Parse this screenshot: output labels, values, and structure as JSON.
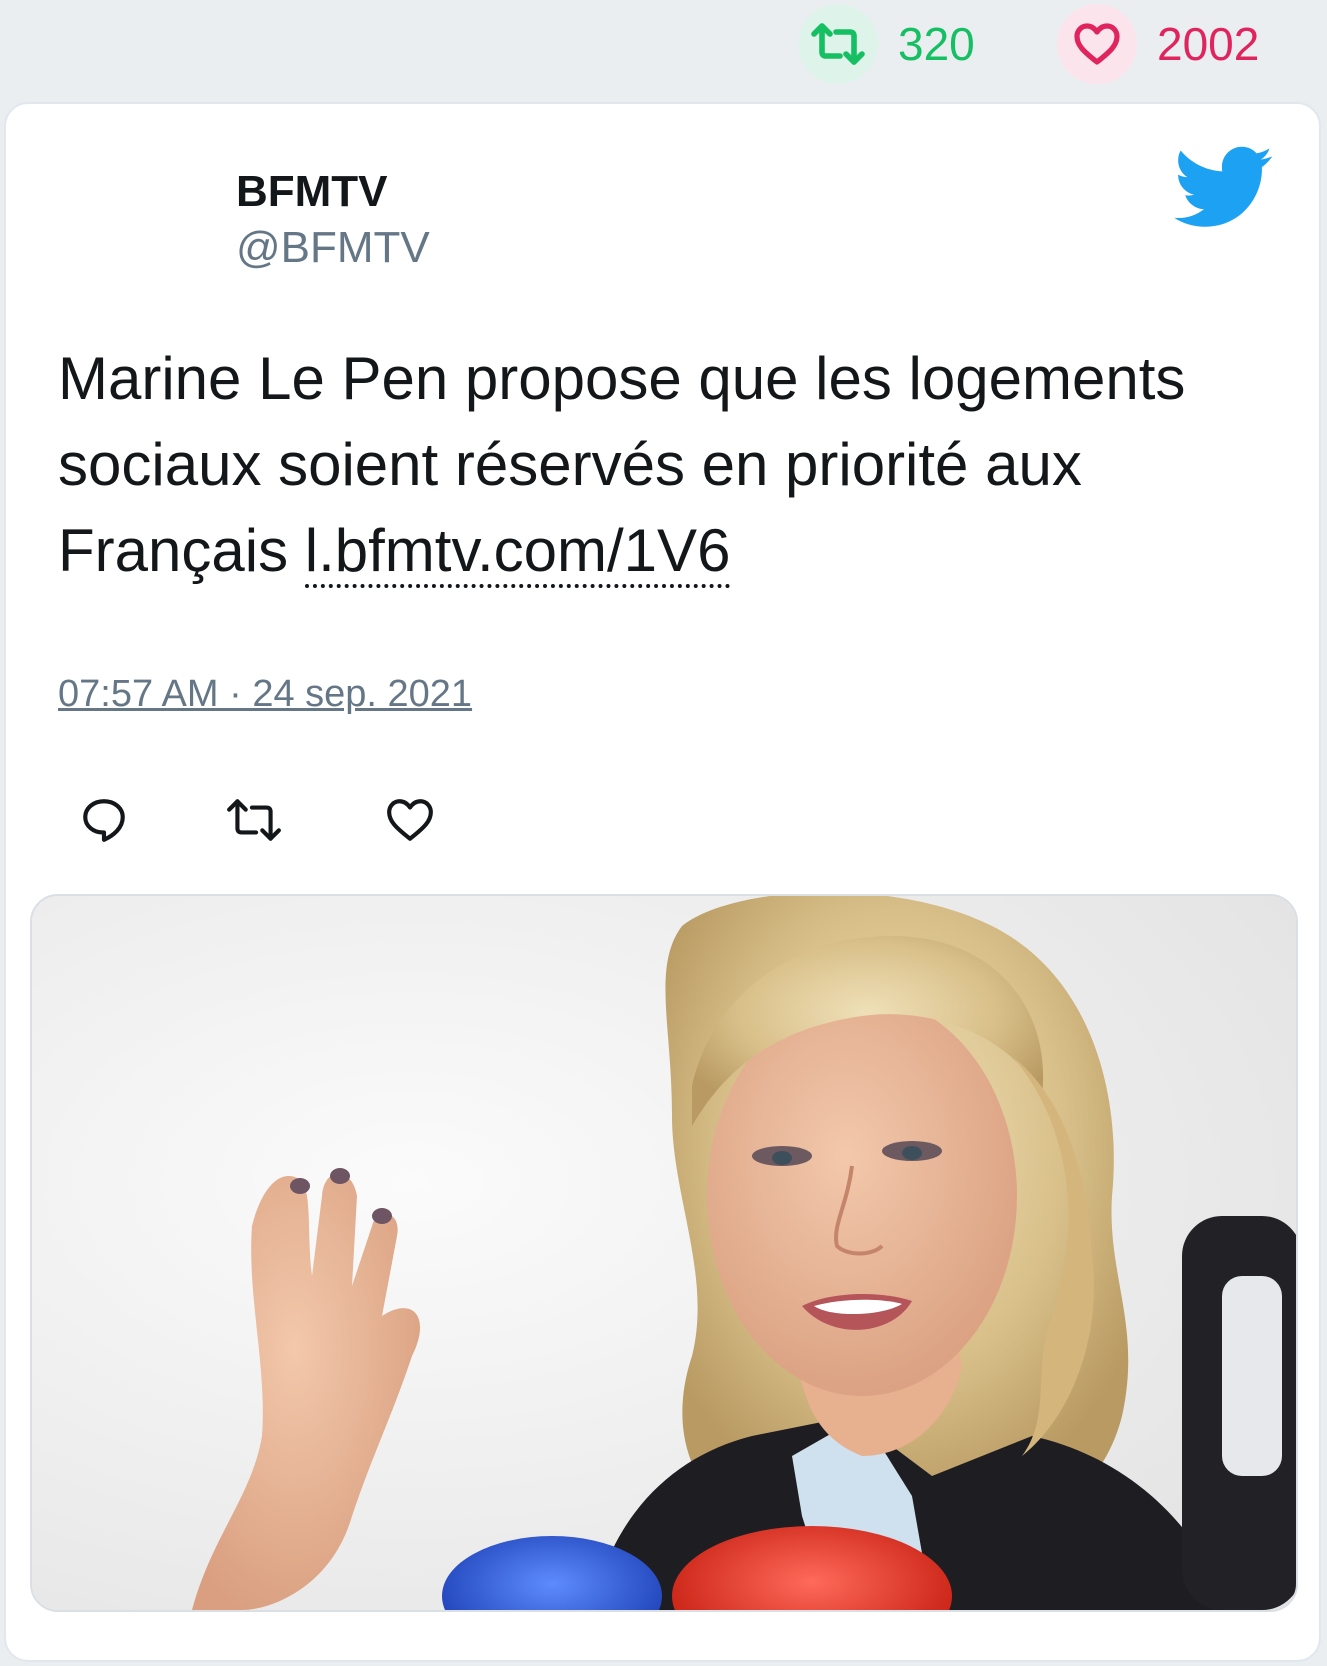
{
  "stats": {
    "retweets": "320",
    "likes": "2002",
    "retweet_icon": "retweet-icon",
    "like_icon": "heart-icon"
  },
  "tweet": {
    "author_name": "BFMTV",
    "author_handle": "@BFMTV",
    "text": "Marine Le Pen propose que les logements sociaux soient réservés en priorité aux Français ",
    "link": "l.bfmtv.com/1V6",
    "timestamp": "07:57 AM · 24 sep. 2021",
    "brand_icon": "twitter-bird-icon"
  },
  "actions": [
    {
      "icon": "reply-icon"
    },
    {
      "icon": "retweet-icon"
    },
    {
      "icon": "heart-icon"
    }
  ],
  "media": {
    "alt": "Photo of a blonde woman in a dark jacket speaking and gesturing in front of microphones"
  },
  "colors": {
    "background": "#ebeef0",
    "retweet_green": "#17bf63",
    "like_pink": "#e0245e",
    "twitter_blue": "#1da1f2",
    "secondary_text": "#657786",
    "primary_text": "#14171a"
  }
}
